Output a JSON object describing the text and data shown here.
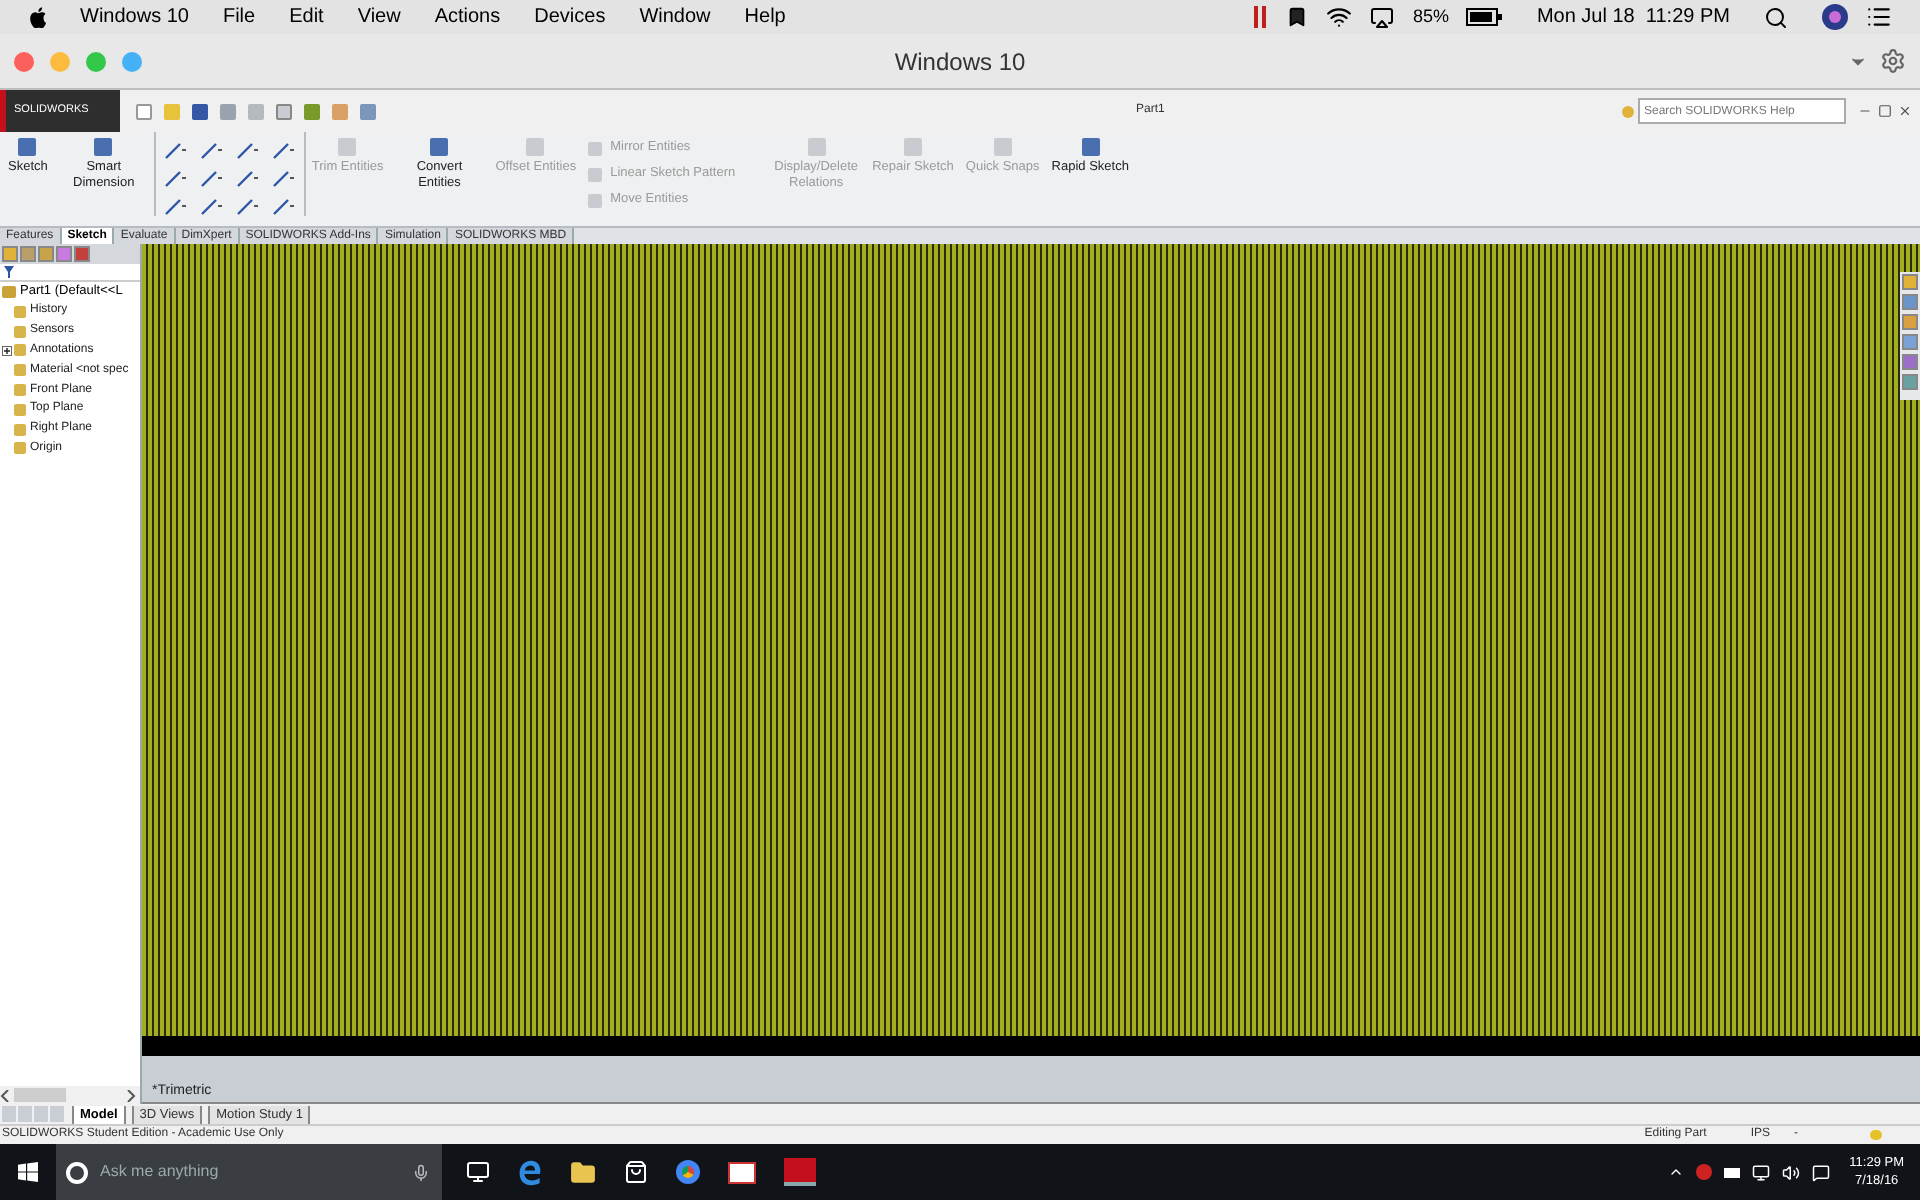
{
  "mac_menu_bar": {
    "items": [
      "Windows 10",
      "File",
      "Edit",
      "View",
      "Actions",
      "Devices",
      "Window",
      "Help"
    ],
    "battery": "85%",
    "clock": "Mon Jul 18  11:29 PM"
  },
  "window": {
    "title": "Windows 10"
  },
  "solidworks": {
    "logo": "SOLIDWORKS",
    "document_title": "Part1",
    "search": {
      "placeholder": "Search SOLIDWORKS Help"
    }
  },
  "ribbon": {
    "commands": [
      {
        "kind": "big",
        "label": "Sketch",
        "disabled": false
      },
      {
        "kind": "big",
        "label": "Smart Dimension",
        "disabled": false
      },
      {
        "kind": "tools"
      },
      {
        "kind": "big",
        "label": "Trim Entities",
        "disabled": true
      },
      {
        "kind": "big",
        "label": "Convert Entities",
        "disabled": false
      },
      {
        "kind": "big",
        "label": "Offset Entities",
        "disabled": true
      },
      {
        "kind": "list",
        "items": [
          {
            "label": "Mirror Entities",
            "disabled": true
          },
          {
            "label": "Linear Sketch Pattern",
            "disabled": true
          },
          {
            "label": "Move Entities",
            "disabled": true
          }
        ]
      },
      {
        "kind": "big",
        "label": "Display/Delete Relations",
        "disabled": true
      },
      {
        "kind": "big",
        "label": "Repair Sketch",
        "disabled": true
      },
      {
        "kind": "big",
        "label": "Quick Snaps",
        "disabled": true
      },
      {
        "kind": "big",
        "label": "Rapid Sketch",
        "disabled": false
      }
    ]
  },
  "command_tabs": [
    {
      "label": "Features",
      "selected": false
    },
    {
      "label": "Sketch",
      "selected": true
    },
    {
      "label": "Evaluate",
      "selected": false
    },
    {
      "label": "DimXpert",
      "selected": false
    },
    {
      "label": "SOLIDWORKS Add-Ins",
      "selected": false
    },
    {
      "label": "Simulation",
      "selected": false
    },
    {
      "label": "SOLIDWORKS MBD",
      "selected": false
    }
  ],
  "feature_tree": {
    "root": {
      "label": "Part1  (Default<<L",
      "children": [
        {
          "label": "History"
        },
        {
          "label": "Sensors"
        },
        {
          "label": "Annotations",
          "expanded": false
        },
        {
          "label": "Material <not spec"
        },
        {
          "label": "Front Plane"
        },
        {
          "label": "Top Plane"
        },
        {
          "label": "Right Plane"
        },
        {
          "label": "Origin"
        }
      ]
    }
  },
  "view": {
    "orientation": "*Trimetric"
  },
  "bottom_tabs": [
    {
      "label": "Model",
      "selected": true
    },
    {
      "label": "3D Views",
      "selected": false
    },
    {
      "label": "Motion Study 1",
      "selected": false
    }
  ],
  "status_bar": {
    "edition": "SOLIDWORKS Student Edition - Academic Use Only",
    "mode": "Editing Part",
    "units": "IPS",
    "extra": "-"
  },
  "taskbar": {
    "search": {
      "placeholder": "Ask me anything"
    },
    "time": "11:29 PM",
    "date": "7/18/16"
  }
}
